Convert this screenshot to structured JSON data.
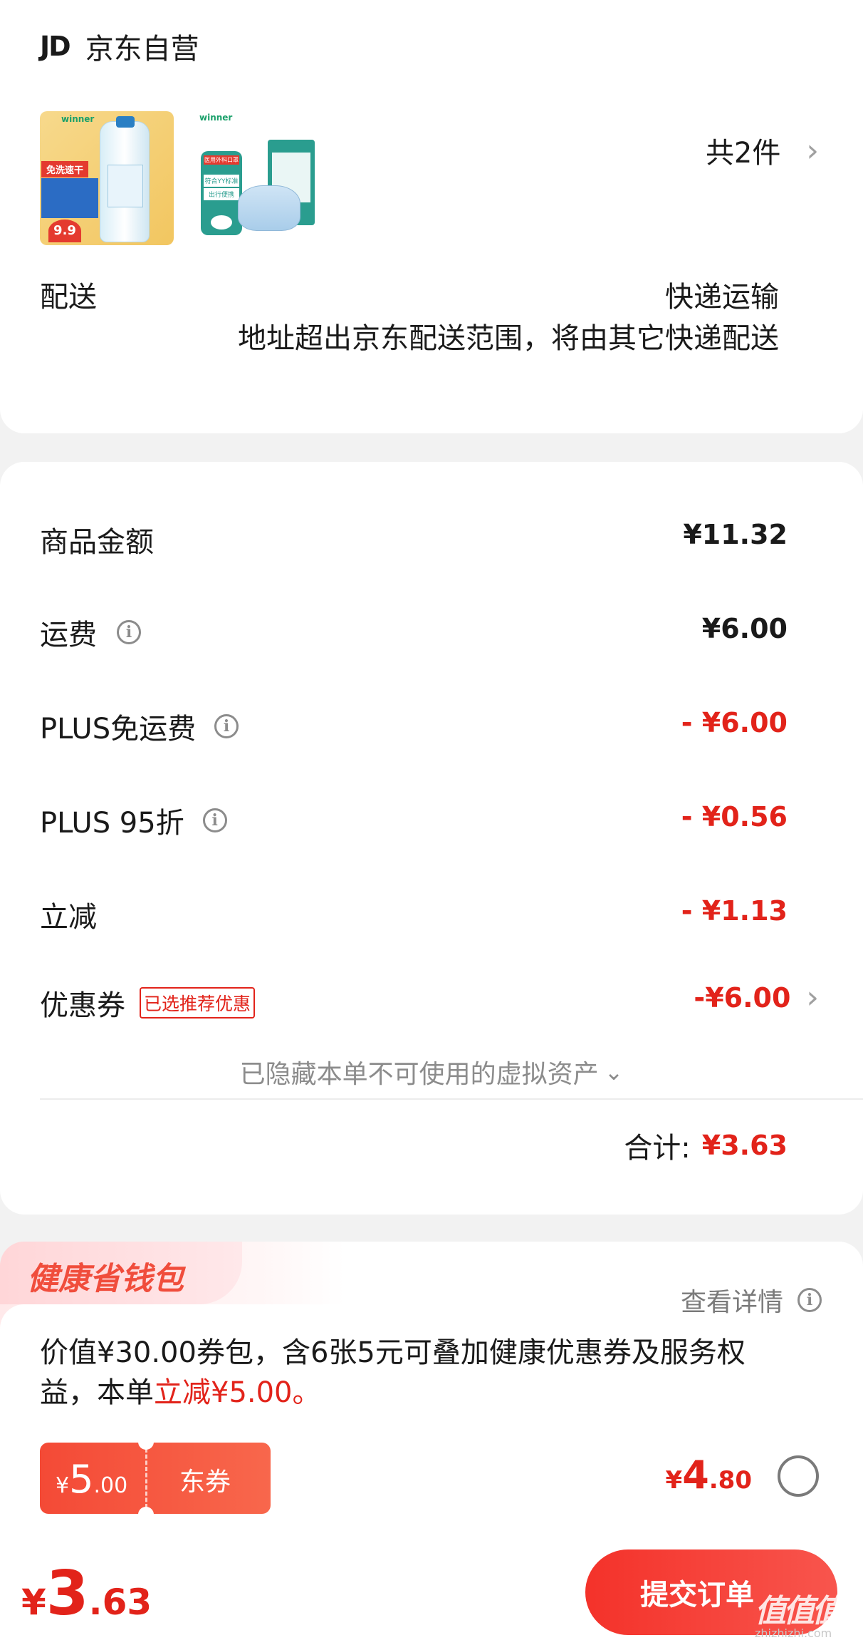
{
  "shop": {
    "logo": "JD",
    "name": "京东自营"
  },
  "products": {
    "item1": {
      "brand": "winner",
      "badge": "免洗速干",
      "price": "9.9"
    },
    "item2": {
      "brand": "winner",
      "label_top": "医用外科口罩",
      "label_mid": "符合YY标准",
      "label_bottom": "出行便携"
    },
    "count": "共2件"
  },
  "delivery": {
    "label": "配送",
    "method": "快递运输",
    "note": "地址超出京东配送范围，将由其它快递配送"
  },
  "summary": {
    "goods_label": "商品金额",
    "goods_value": "¥11.32",
    "shipping_label": "运费",
    "shipping_value": "¥6.00",
    "plus_free_label": "PLUS免运费",
    "plus_free_value": "- ¥6.00",
    "plus95_label": "PLUS 95折",
    "plus95_value": "- ¥0.56",
    "instant_label": "立减",
    "instant_value": "- ¥1.13",
    "coupon_label": "优惠券",
    "coupon_tag": "已选推荐优惠",
    "coupon_value": "-¥6.00",
    "hidden_note": "已隐藏本单不可使用的虚拟资产",
    "total_label": "合计:",
    "total_value": "¥3.63"
  },
  "health": {
    "title": "健康省钱包",
    "details": "查看详情",
    "desc_line1": "价值¥30.00券包，含6张5元可叠加健康优惠券及服务权",
    "desc_line2_a": "益，本单",
    "desc_line2_b": "立减¥5.00。",
    "coupon_symbol": "¥",
    "coupon_int": "5",
    "coupon_dec": ".00",
    "coupon_type": "东券",
    "price_symbol": "¥",
    "price_int": "4",
    "price_dec": ".80"
  },
  "bottom": {
    "symbol": "¥",
    "int": "3",
    "dec": ".63",
    "submit": "提交订单",
    "watermark": "值值值",
    "watermark_url": "zhizhizhi.com"
  },
  "colors": {
    "accent": "#e2231a",
    "background": "#f2f2f2"
  }
}
